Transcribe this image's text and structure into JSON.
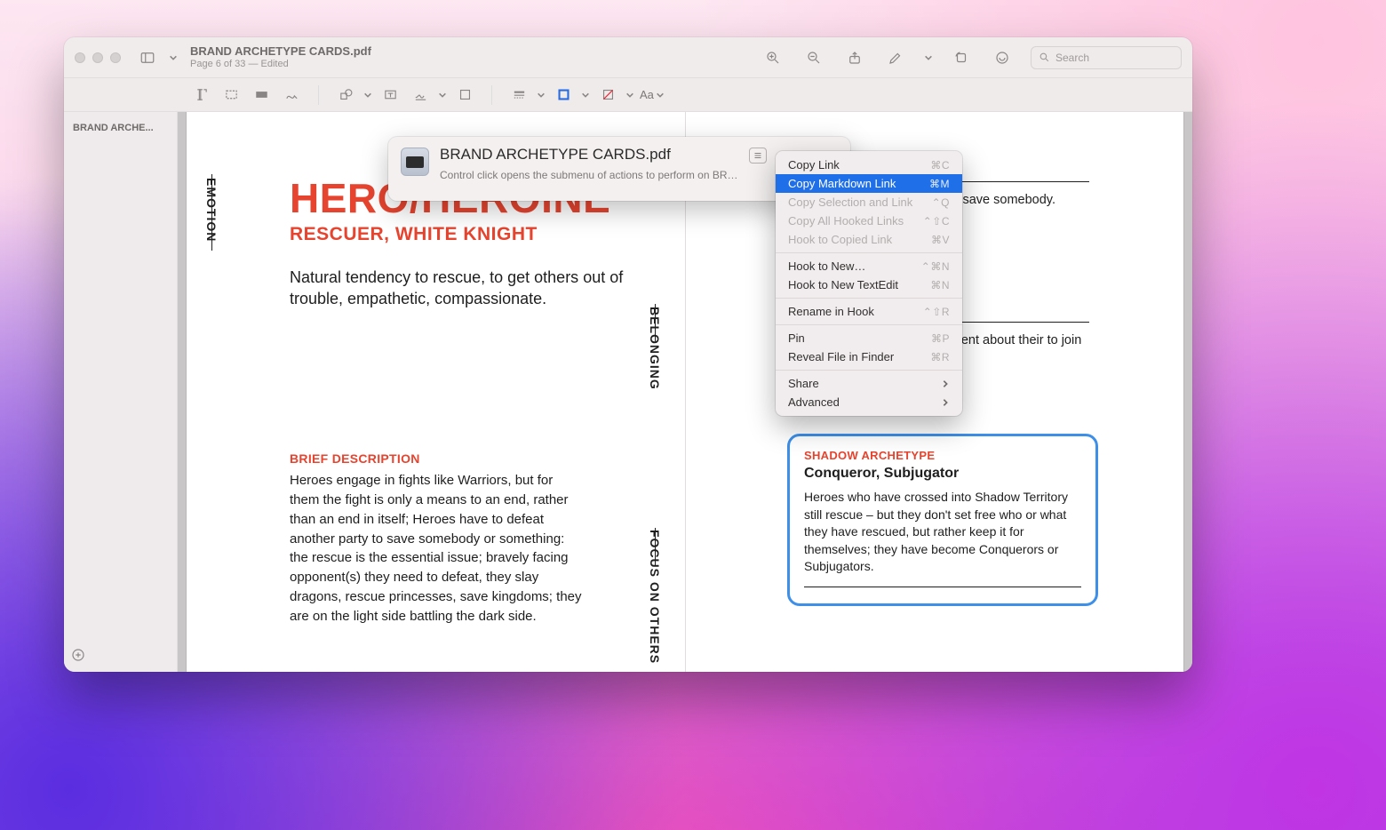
{
  "window": {
    "title": "BRAND ARCHETYPE CARDS.pdf",
    "subtitle": "Page 6 of 33 — Edited",
    "search_placeholder": "Search"
  },
  "sidebar": {
    "thumb_label": "BRAND ARCHE..."
  },
  "toolbar2": {
    "text_style_label": "Aa"
  },
  "doc": {
    "emotion_label": "EMOTION",
    "belonging_label": "BELONGING",
    "focus_label": "FOCUS ON OTHERS",
    "h1": "HERO/HEROINE",
    "h2": "RESCUER, WHITE KNIGHT",
    "lead": "Natural tendency to rescue, to get others out of trouble, empathetic, compassionate.",
    "brief_title": "BRIEF DESCRIPTION",
    "brief_body": "Heroes engage in fights like Warriors, but for them the fight is only a means to an end, rather than an end in itself; Heroes have to defeat another party to save somebody or something: the rescue is the essential issue; bravely facing opponent(s) they need to defeat, they slay dragons, rescue princesses, save kingdoms; they are on the light side battling the dark side.",
    "shadow_title": "SHADOW ARCHETYPE",
    "shadow_sub": "Conqueror, Subjugator",
    "shadow_body": "Heroes who have crossed into Shadow Territory still rescue – but they don't set free who or what they have rescued, but rather keep it for themselves; they have become Conquerors or Subjugators.",
    "story_tail": "is in trouble; an unexpected to save somebody.",
    "strategy_tail": "d to be rescued; r problem by lent about their to join a brand ng."
  },
  "hook": {
    "title": "BRAND ARCHETYPE CARDS.pdf",
    "subtitle": "Control click opens the submenu of actions to perform on BRAND ARCHETYPE CARDS.pdf"
  },
  "menu": {
    "items": [
      {
        "label": "Copy Link",
        "shortcut": "⌘C",
        "disabled": false,
        "selected": false
      },
      {
        "label": "Copy Markdown Link",
        "shortcut": "⌘M",
        "disabled": false,
        "selected": true
      },
      {
        "label": "Copy Selection and Link",
        "shortcut": "⌃Q",
        "disabled": true,
        "selected": false
      },
      {
        "label": "Copy All Hooked Links",
        "shortcut": "⌃⇧C",
        "disabled": true,
        "selected": false
      },
      {
        "label": "Hook to Copied Link",
        "shortcut": "⌘V",
        "disabled": true,
        "selected": false
      }
    ],
    "items2": [
      {
        "label": "Hook to New…",
        "shortcut": "⌃⌘N"
      },
      {
        "label": "Hook to New TextEdit",
        "shortcut": "⌘N"
      }
    ],
    "items3": [
      {
        "label": "Rename in Hook",
        "shortcut": "⌃⇧R"
      }
    ],
    "items4": [
      {
        "label": "Pin",
        "shortcut": "⌘P"
      },
      {
        "label": "Reveal File in Finder",
        "shortcut": "⌘R"
      }
    ],
    "items5": [
      {
        "label": "Share",
        "submenu": true
      },
      {
        "label": "Advanced",
        "submenu": true
      }
    ]
  }
}
